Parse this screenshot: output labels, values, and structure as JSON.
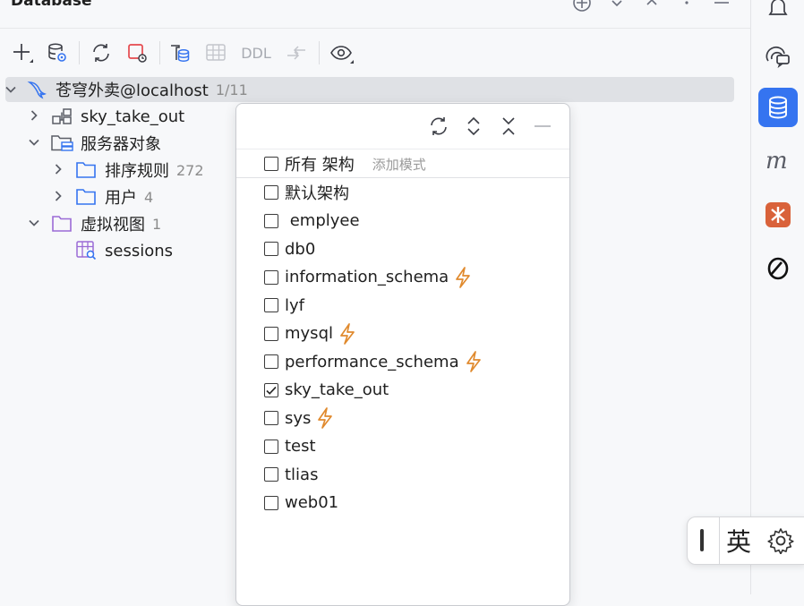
{
  "header": {
    "title": "Database"
  },
  "toolbar": {
    "ddl_label": "DDL"
  },
  "tree": {
    "root": {
      "label": "苍穹外卖@localhost",
      "count": "1/11"
    },
    "items": [
      {
        "label": "sky_take_out",
        "count": ""
      },
      {
        "label": "服务器对象",
        "count": ""
      },
      {
        "label": "排序规则",
        "count": "272"
      },
      {
        "label": "用户",
        "count": "4"
      },
      {
        "label": "虚拟视图",
        "count": "1"
      },
      {
        "label": "sessions",
        "count": ""
      }
    ]
  },
  "popup": {
    "all_label": "所有 架构",
    "placeholder": "添加模式",
    "options": [
      {
        "label": "默认架构",
        "checked": false,
        "bolt": false
      },
      {
        "label": " emplyee",
        "checked": false,
        "bolt": false
      },
      {
        "label": "db0",
        "checked": false,
        "bolt": false
      },
      {
        "label": "information_schema",
        "checked": false,
        "bolt": true
      },
      {
        "label": "lyf",
        "checked": false,
        "bolt": false
      },
      {
        "label": "mysql",
        "checked": false,
        "bolt": true
      },
      {
        "label": "performance_schema",
        "checked": false,
        "bolt": true
      },
      {
        "label": "sky_take_out",
        "checked": true,
        "bolt": false
      },
      {
        "label": "sys",
        "checked": false,
        "bolt": true
      },
      {
        "label": "test",
        "checked": false,
        "bolt": false
      },
      {
        "label": "tlias",
        "checked": false,
        "bolt": false
      },
      {
        "label": "web01",
        "checked": false,
        "bolt": false
      }
    ]
  },
  "ime": {
    "language": "英"
  },
  "colors": {
    "accent": "#3574f0",
    "bolt": "#e08a2e",
    "folder": "#3574f0",
    "virtual_folder": "#9b6bd6",
    "stop": "#e5484d"
  },
  "icons": {
    "sidebar": [
      "notifications-icon",
      "ai-chat-icon",
      "database-icon",
      "mybatis-m-icon",
      "plugin-icon",
      "copilot-icon"
    ]
  }
}
